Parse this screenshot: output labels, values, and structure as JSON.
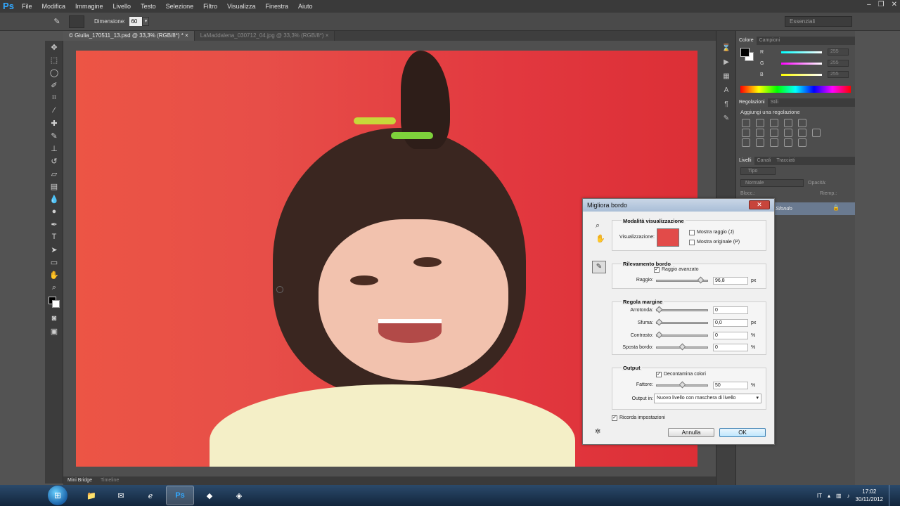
{
  "app": {
    "logo": "Ps"
  },
  "menubar": {
    "items": [
      "File",
      "Modifica",
      "Immagine",
      "Livello",
      "Testo",
      "Selezione",
      "Filtro",
      "Visualizza",
      "Finestra",
      "Aiuto"
    ]
  },
  "window_controls": [
    "minimize-icon",
    "restore-icon",
    "close-icon"
  ],
  "options_bar": {
    "dimension_label": "Dimensione:",
    "dimension_value": "60",
    "workspace": "Essenziali"
  },
  "tabs": [
    {
      "label": "© Giulia_170511_13.psd @ 33,3% (RGB/8*) *",
      "active": true
    },
    {
      "label": "LaMaddalena_030712_04.jpg @ 33,3% (RGB/8*)",
      "active": false
    }
  ],
  "bottom_tabs": [
    "Mini Bridge",
    "Timeline"
  ],
  "panels": {
    "color_tabs": [
      "Colore",
      "Campioni"
    ],
    "color_sliders": [
      {
        "letter": "R",
        "value": "255"
      },
      {
        "letter": "G",
        "value": "255"
      },
      {
        "letter": "B",
        "value": "255"
      }
    ],
    "adjust_tabs": [
      "Regolazioni",
      "Stili"
    ],
    "adjust_title": "Aggiungi una regolazione",
    "layers_tabs": [
      "Livelli",
      "Canali",
      "Tracciati"
    ],
    "layers_kind": "Tipo",
    "blend_mode": "Normale",
    "opacity_label": "Opacità:",
    "lock_label": "Blocc.:",
    "fill_label": "Riemp.:",
    "layer_name": "Sfondo"
  },
  "dialog": {
    "title": "Migliora bordo",
    "view_mode": {
      "title": "Modalità visualizzazione",
      "view_label": "Visualizzazione:",
      "show_radius": "Mostra raggio (J)",
      "show_original": "Mostra originale (P)"
    },
    "edge_detection": {
      "title": "Rilevamento bordo",
      "smart_radius": "Raggio avanzato",
      "radius_label": "Raggio:",
      "radius_value": "96,8",
      "radius_unit": "px",
      "radius_level": 0.9
    },
    "adjust_edge": {
      "title": "Regola margine",
      "fields": [
        {
          "label": "Arrotonda:",
          "value": "0",
          "unit": "",
          "level": 0.0
        },
        {
          "label": "Sfuma:",
          "value": "0,0",
          "unit": "px",
          "level": 0.0
        },
        {
          "label": "Contrasto:",
          "value": "0",
          "unit": "%",
          "level": 0.0
        },
        {
          "label": "Sposta bordo:",
          "value": "0",
          "unit": "%",
          "level": 0.5
        }
      ]
    },
    "output": {
      "title": "Output",
      "decontaminate": "Decontamina colori",
      "amount_label": "Fattore:",
      "amount_value": "50",
      "amount_unit": "%",
      "amount_level": 0.5,
      "output_to_label": "Output in:",
      "output_to_value": "Nuovo livello con maschera di livello"
    },
    "remember": "Ricorda impostazioni",
    "cancel": "Annulla",
    "ok": "OK"
  },
  "taskbar": {
    "lang": "IT",
    "time": "17:02",
    "date": "30/11/2012"
  }
}
